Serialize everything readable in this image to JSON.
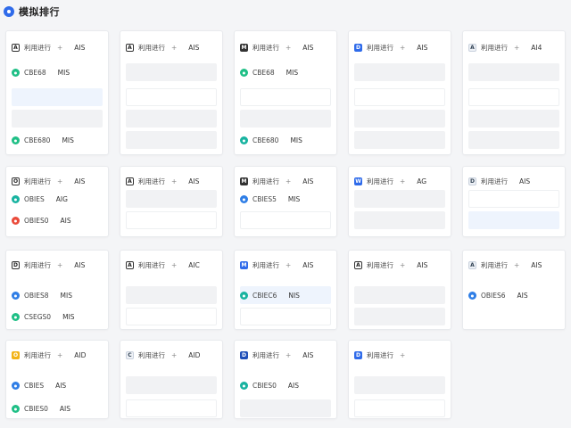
{
  "header": {
    "title": "模拟排行"
  },
  "cards": [
    {
      "rows": [
        {
          "kind": "head",
          "icon": "A",
          "icon_style": "outline-dark",
          "label": "利用进行",
          "dash": "+",
          "value": "AIS"
        },
        {
          "kind": "item",
          "icon": "green-circle",
          "label": "CBE68",
          "value": "MIS"
        },
        {
          "kind": "tinted"
        },
        {
          "kind": "placeholder"
        },
        {
          "kind": "item",
          "icon": "green-circle",
          "label": "CBE680",
          "value": "MIS"
        }
      ]
    },
    {
      "rows": [
        {
          "kind": "head",
          "icon": "A",
          "icon_style": "outline-dark",
          "label": "利用进行",
          "dash": "+",
          "value": "AIS"
        },
        {
          "kind": "placeholder"
        },
        {
          "kind": "outline"
        },
        {
          "kind": "placeholder"
        },
        {
          "kind": "placeholder"
        }
      ]
    },
    {
      "rows": [
        {
          "kind": "head",
          "icon": "M",
          "icon_style": "dark",
          "label": "利用进行",
          "dash": "+",
          "value": "AIS"
        },
        {
          "kind": "item",
          "icon": "green-circle",
          "label": "CBE68",
          "value": "MIS"
        },
        {
          "kind": "outline"
        },
        {
          "kind": "placeholder"
        },
        {
          "kind": "item",
          "icon": "teal-circle",
          "label": "CBE680",
          "value": "MIS"
        }
      ]
    },
    {
      "rows": [
        {
          "kind": "head",
          "icon": "D",
          "icon_style": "blue",
          "label": "利用进行",
          "dash": "+",
          "value": "AIS"
        },
        {
          "kind": "placeholder"
        },
        {
          "kind": "outline"
        },
        {
          "kind": "placeholder"
        },
        {
          "kind": "placeholder"
        }
      ]
    },
    {
      "rows": [
        {
          "kind": "head",
          "icon": "A",
          "icon_style": "light",
          "label": "利用进行",
          "dash": "+",
          "value": "AI4"
        },
        {
          "kind": "placeholder"
        },
        {
          "kind": "outline"
        },
        {
          "kind": "placeholder"
        },
        {
          "kind": "placeholder"
        }
      ]
    },
    {
      "rows": [
        {
          "kind": "head",
          "icon": "O",
          "icon_style": "outline-dark",
          "label": "利用进行",
          "dash": "+",
          "value": "AIS"
        },
        {
          "kind": "item",
          "icon": "teal-circle",
          "label": "OBIES",
          "value": "AIG"
        },
        {
          "kind": "item",
          "icon": "red-circle",
          "label": "OBIES0",
          "value": "AIS"
        }
      ]
    },
    {
      "rows": [
        {
          "kind": "head",
          "icon": "A",
          "icon_style": "outline-dark",
          "label": "利用进行",
          "dash": "+",
          "value": "AIS"
        },
        {
          "kind": "placeholder"
        },
        {
          "kind": "outline"
        }
      ]
    },
    {
      "rows": [
        {
          "kind": "head",
          "icon": "M",
          "icon_style": "dark",
          "label": "利用进行",
          "dash": "+",
          "value": "AIS"
        },
        {
          "kind": "item",
          "icon": "blue-circle",
          "label": "CBIES5",
          "value": "MIS"
        },
        {
          "kind": "outline"
        }
      ]
    },
    {
      "rows": [
        {
          "kind": "head",
          "icon": "W",
          "icon_style": "blue",
          "label": "利用进行",
          "dash": "+",
          "value": "AG"
        },
        {
          "kind": "placeholder"
        },
        {
          "kind": "placeholder"
        }
      ]
    },
    {
      "rows": [
        {
          "kind": "head",
          "icon": "D",
          "icon_style": "light",
          "label": "利用进行",
          "dash": "",
          "value": "AIS"
        },
        {
          "kind": "outline"
        },
        {
          "kind": "tinted"
        }
      ]
    },
    {
      "rows": [
        {
          "kind": "head",
          "icon": "D",
          "icon_style": "outline-dark",
          "label": "利用进行",
          "dash": "+",
          "value": "AIS"
        },
        {
          "kind": "item",
          "icon": "blue-circle",
          "label": "OBIES8",
          "value": "MIS"
        },
        {
          "kind": "item",
          "icon": "green-circle",
          "label": "CSEGS0",
          "value": "MIS"
        }
      ]
    },
    {
      "rows": [
        {
          "kind": "head",
          "icon": "A",
          "icon_style": "outline-dark",
          "label": "利用进行",
          "dash": "+",
          "value": "AIC"
        },
        {
          "kind": "placeholder"
        },
        {
          "kind": "outline"
        }
      ]
    },
    {
      "rows": [
        {
          "kind": "head",
          "icon": "M",
          "icon_style": "blue",
          "label": "利用进行",
          "dash": "+",
          "value": "AIS"
        },
        {
          "kind": "item-tinted",
          "icon": "teal-circle",
          "label": "CBIEC6",
          "value": "NIS"
        },
        {
          "kind": "outline"
        }
      ]
    },
    {
      "rows": [
        {
          "kind": "head",
          "icon": "A",
          "icon_style": "outline-dark",
          "label": "利用进行",
          "dash": "+",
          "value": "AIS"
        },
        {
          "kind": "placeholder"
        },
        {
          "kind": "placeholder"
        }
      ]
    },
    {
      "rows": [
        {
          "kind": "head",
          "icon": "A",
          "icon_style": "light",
          "label": "利用进行",
          "dash": "+",
          "value": "AIS"
        },
        {
          "kind": "item",
          "icon": "blue-circle",
          "label": "OBIES6",
          "value": "AIS"
        }
      ]
    },
    {
      "rows": [
        {
          "kind": "head",
          "icon": "O",
          "icon_style": "orange",
          "label": "利用进行",
          "dash": "+",
          "value": "AID"
        },
        {
          "kind": "item",
          "icon": "blue-circle",
          "label": "CBIES",
          "value": "AIS"
        },
        {
          "kind": "item",
          "icon": "green-circle",
          "label": "CBIES0",
          "value": "AIS"
        }
      ]
    },
    {
      "rows": [
        {
          "kind": "head",
          "icon": "C",
          "icon_style": "light",
          "label": "利用进行",
          "dash": "+",
          "value": "AID"
        },
        {
          "kind": "placeholder"
        },
        {
          "kind": "outline"
        }
      ]
    },
    {
      "rows": [
        {
          "kind": "head",
          "icon": "D",
          "icon_style": "navy",
          "label": "利用进行",
          "dash": "+",
          "value": "AIS"
        },
        {
          "kind": "item",
          "icon": "teal-circle",
          "label": "CBIES0",
          "value": "AIS"
        },
        {
          "kind": "placeholder"
        }
      ]
    },
    {
      "rows": [
        {
          "kind": "head",
          "icon": "D",
          "icon_style": "blue",
          "label": "利用进行",
          "dash": "+",
          "value": ""
        },
        {
          "kind": "placeholder"
        },
        {
          "kind": "outline"
        }
      ]
    }
  ],
  "colors": {
    "accent": "#2f6bea",
    "green": "#1fbf86",
    "teal": "#18b3a0",
    "red": "#ea4a3a",
    "orange": "#f2b318",
    "blue": "#2f7ee6"
  }
}
